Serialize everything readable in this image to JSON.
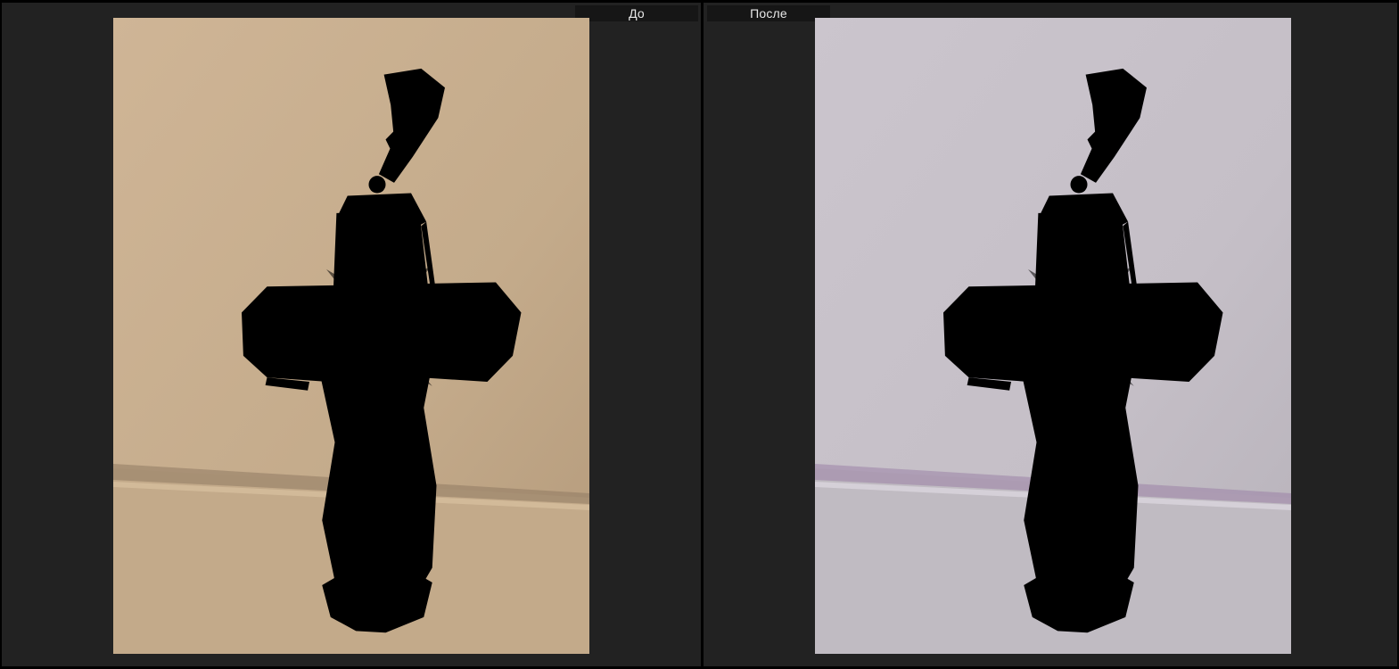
{
  "viewer": {
    "before": {
      "label": "До",
      "photo_icon": "cross-pendant-photo",
      "background_top": "#c9b092",
      "background_bottom": "#c2a98a",
      "metal_light": "#e6dcb8",
      "metal_dark": "#2d2a1e"
    },
    "after": {
      "label": "После",
      "photo_icon": "cross-pendant-photo",
      "background_top": "#c9c3cb",
      "background_bottom": "#beb9c0",
      "metal_light": "#efece6",
      "metal_dark": "#2a2a28"
    },
    "frame_color": "#222222"
  }
}
